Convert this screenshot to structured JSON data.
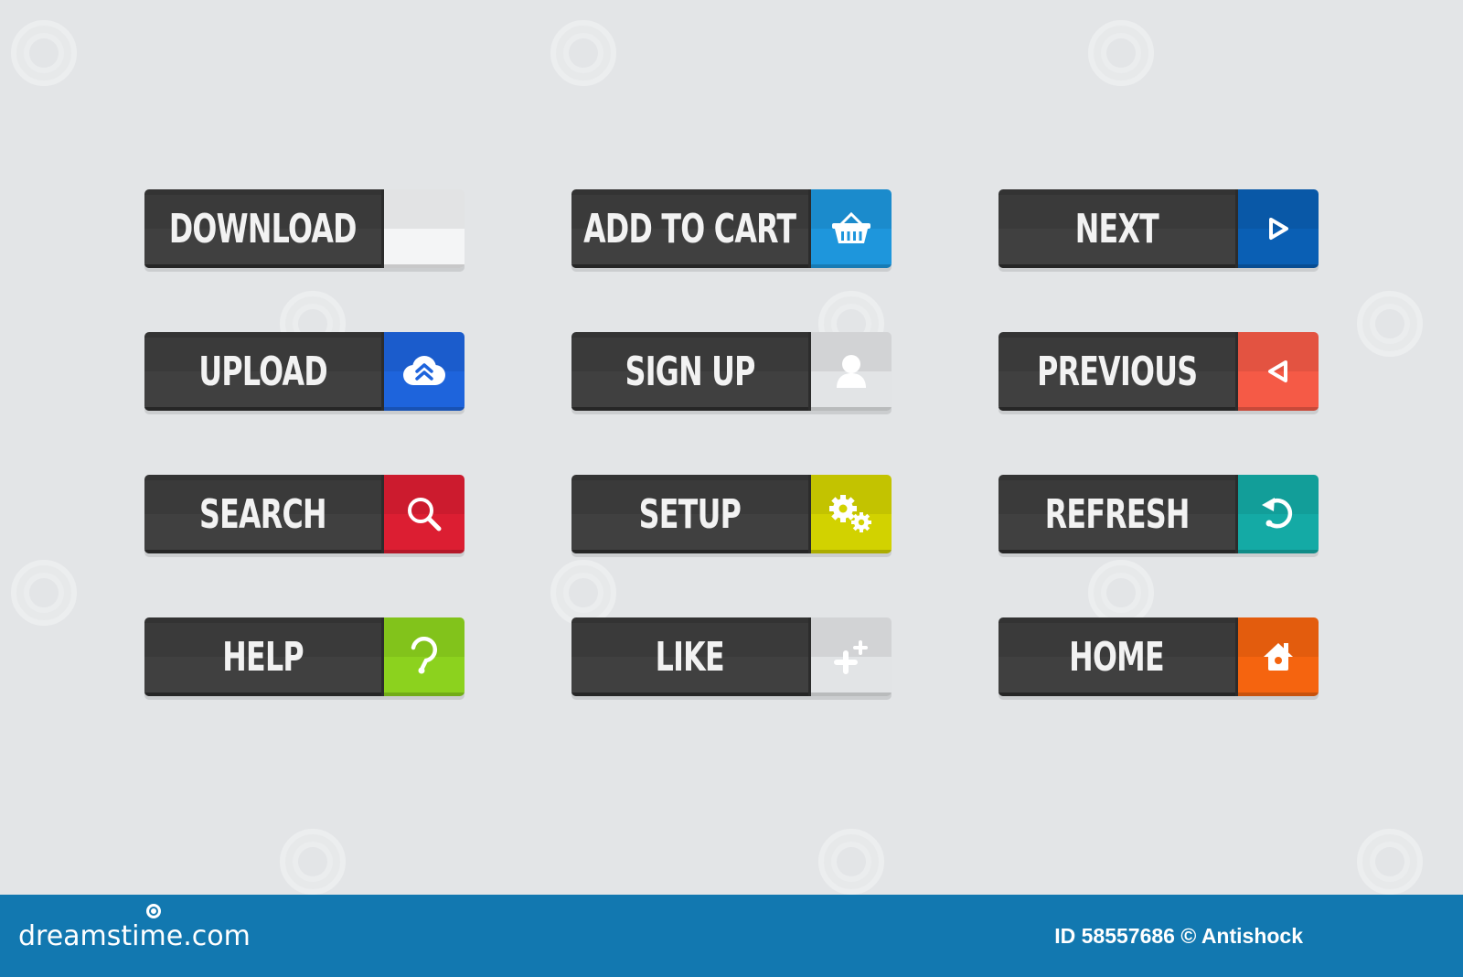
{
  "buttons": [
    {
      "label": "Download",
      "icon": "download-icon",
      "color": "#f4f5f6"
    },
    {
      "label": "Add to cart",
      "icon": "basket-icon",
      "color": "#1e96dc"
    },
    {
      "label": "Next",
      "icon": "play-right-icon",
      "color": "#0a5fb4"
    },
    {
      "label": "Upload",
      "icon": "cloud-upload-icon",
      "color": "#1e64dc"
    },
    {
      "label": "Sign up",
      "icon": "user-icon",
      "color": "#e2e4e6"
    },
    {
      "label": "Previous",
      "icon": "play-left-icon",
      "color": "#f55a46"
    },
    {
      "label": "Search",
      "icon": "search-icon",
      "color": "#dc1e32"
    },
    {
      "label": "Setup",
      "icon": "gears-icon",
      "color": "#d2d200"
    },
    {
      "label": "Refresh",
      "icon": "refresh-icon",
      "color": "#14aaa5"
    },
    {
      "label": "Help",
      "icon": "question-icon",
      "color": "#8cd21e"
    },
    {
      "label": "Like",
      "icon": "plus-one-icon",
      "color": "#e2e4e6"
    },
    {
      "label": "Home",
      "icon": "home-icon",
      "color": "#f5640f"
    }
  ],
  "footer": {
    "brand": "dreamstime.com",
    "credit": "ID 58557686 © Antishock"
  },
  "colors": {
    "background": "#e3e5e7",
    "button_dark": "#3a3a3a",
    "footer": "#1278b0"
  }
}
